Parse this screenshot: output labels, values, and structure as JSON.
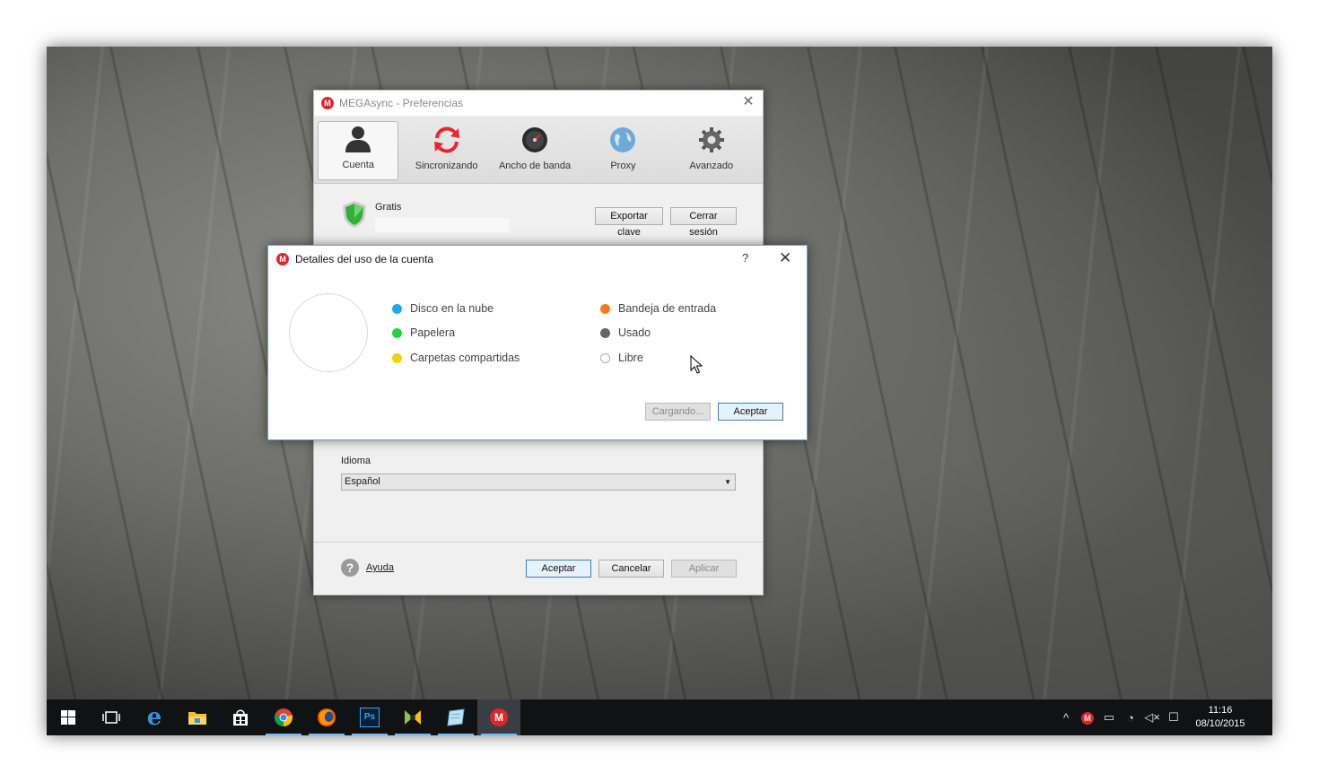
{
  "prefs": {
    "title": "MEGAsync - Preferencias",
    "tabs": [
      {
        "label": "Cuenta"
      },
      {
        "label": "Sincronizando"
      },
      {
        "label": "Ancho de banda"
      },
      {
        "label": "Proxy"
      },
      {
        "label": "Avanzado"
      }
    ],
    "plan": "Gratis",
    "export_key": "Exportar clave",
    "logout": "Cerrar sesión",
    "language_label": "Idioma",
    "language_value": "Español",
    "help": "Ayuda",
    "accept": "Aceptar",
    "cancel": "Cancelar",
    "apply": "Aplicar"
  },
  "details": {
    "title": "Detalles del uso de la cuenta",
    "help_mark": "?",
    "legend": [
      {
        "label": "Disco en la nube",
        "color": "#2aa5e6"
      },
      {
        "label": "Papelera",
        "color": "#2ecc40"
      },
      {
        "label": "Carpetas compartidas",
        "color": "#f2d20a"
      },
      {
        "label": "Bandeja de entrada",
        "color": "#f47b20"
      },
      {
        "label": "Usado",
        "color": "#666666"
      },
      {
        "label": "Libre",
        "color": "#ffffff"
      }
    ],
    "loading": "Cargando...",
    "accept": "Aceptar"
  },
  "taskbar": {
    "apps": [
      "start-icon",
      "task-view-icon",
      "edge-icon",
      "file-explorer-icon",
      "store-icon",
      "chrome-icon",
      "firefox-icon",
      "photoshop-icon",
      "app-icon",
      "notepad-icon",
      "mega-icon"
    ],
    "clock_time": "11:16",
    "clock_date": "08/10/2015"
  }
}
